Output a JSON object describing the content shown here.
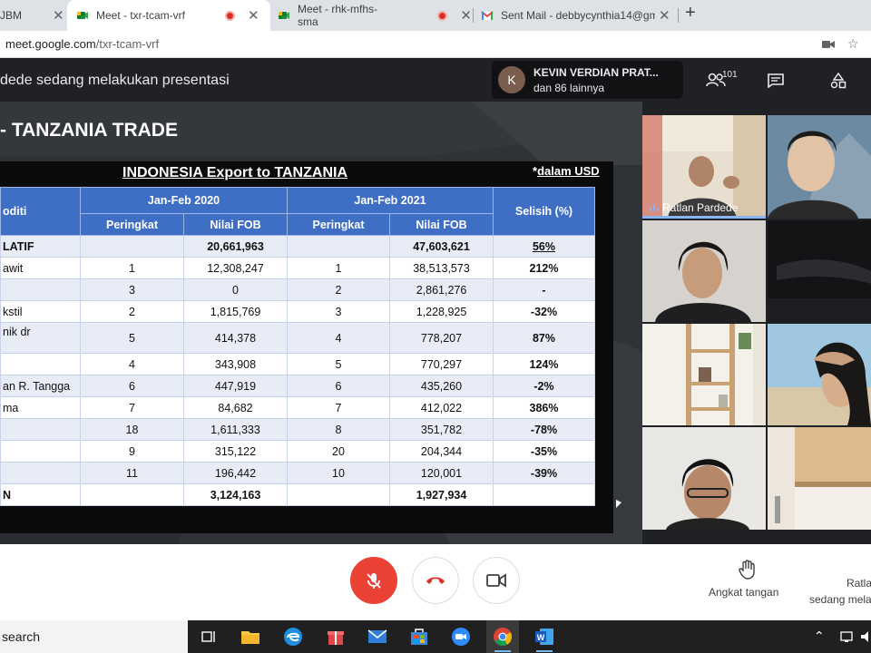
{
  "browser": {
    "tabs": [
      {
        "label": "JBM"
      },
      {
        "label": "Meet - txr-tcam-vrf"
      },
      {
        "label": "Meet - rhk-mfhs-sma"
      },
      {
        "label": "Sent Mail - debbycynthia14@gm"
      }
    ],
    "new_tab": "+",
    "url_host": "meet.google.com",
    "url_path": "/txr-tcam-vrf"
  },
  "meet": {
    "presenting_text": "dede sedang melakukan presentasi",
    "speaker_initial": "K",
    "speaker_name": "KEVIN VERDIAN PRAT...",
    "speaker_sub": "dan 86 lainnya",
    "participant_count": "101"
  },
  "slide": {
    "title": "- TANZANIA TRADE",
    "table_title": "INDONESIA Export to TANZANIA",
    "note_star": "*",
    "note_text": "dalam USD",
    "headers": {
      "komoditi": "oditi",
      "period1": "Jan-Feb 2020",
      "period2": "Jan-Feb 2021",
      "selisih": "Selisih (%)",
      "peringkat": "Peringkat",
      "nilai_fob": "Nilai FOB"
    },
    "rows": [
      {
        "komoditi": "LATIF",
        "r1": "",
        "v1": "20,661,963",
        "r2": "",
        "v2": "47,603,621",
        "pct": "56%",
        "style": "total"
      },
      {
        "komoditi": "awit",
        "r1": "1",
        "v1": "12,308,247",
        "r2": "1",
        "v2": "38,513,573",
        "pct": "212%",
        "style": "pos"
      },
      {
        "komoditi": "",
        "r1": "3",
        "v1": "0",
        "r2": "2",
        "v2": "2,861,276",
        "pct": "-",
        "style": "neu"
      },
      {
        "komoditi": "kstil",
        "r1": "2",
        "v1": "1,815,769",
        "r2": "3",
        "v2": "1,228,925",
        "pct": "-32%",
        "style": "neg"
      },
      {
        "komoditi": "nik dr",
        "r1": "5",
        "v1": "414,378",
        "r2": "4",
        "v2": "778,207",
        "pct": "87%",
        "style": "pos"
      },
      {
        "komoditi": "",
        "r1": "4",
        "v1": "343,908",
        "r2": "5",
        "v2": "770,297",
        "pct": "124%",
        "style": "pos"
      },
      {
        "komoditi": "an R. Tangga",
        "r1": "6",
        "v1": "447,919",
        "r2": "6",
        "v2": "435,260",
        "pct": "-2%",
        "style": "neg"
      },
      {
        "komoditi": "ma",
        "r1": "7",
        "v1": "84,682",
        "r2": "7",
        "v2": "412,022",
        "pct": "386%",
        "style": "pos"
      },
      {
        "komoditi": "",
        "r1": "18",
        "v1": "1,611,333",
        "r2": "8",
        "v2": "351,782",
        "pct": "-78%",
        "style": "neg"
      },
      {
        "komoditi": "",
        "r1": "9",
        "v1": "315,122",
        "r2": "20",
        "v2": "204,344",
        "pct": "-35%",
        "style": "neg"
      },
      {
        "komoditi": "",
        "r1": "11",
        "v1": "196,442",
        "r2": "10",
        "v2": "120,001",
        "pct": "-39%",
        "style": "neg"
      },
      {
        "komoditi": "N",
        "r1": "",
        "v1": "3,124,163",
        "r2": "",
        "v2": "1,927,934",
        "pct": "",
        "style": "bold"
      }
    ]
  },
  "participants": {
    "tile1_name": "Ratlan Pardede"
  },
  "controls": {
    "raise_hand": "Angkat tangan",
    "presenter_line1": "Ratla",
    "presenter_line2": "sedang mela"
  },
  "taskbar": {
    "search": "search"
  },
  "colors": {
    "accent_blue": "#3f6fc4",
    "positive": "#1f9d3a",
    "negative": "#e02020",
    "mic_off": "#ea4335"
  }
}
